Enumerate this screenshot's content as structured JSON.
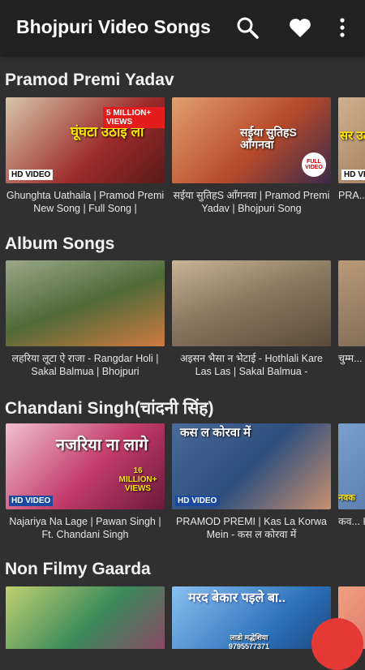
{
  "appbar": {
    "title": "Bhojpuri Video Songs"
  },
  "sections": [
    {
      "title": "Pramod Premi Yadav",
      "cards": [
        {
          "caption": "Ghunghta Uathaila | Pramod Premi New Song | Full Song |",
          "overlay": "घूंघटा उठाई ला",
          "badge": "5 MILLION+ VIEWS",
          "hd": "HD VIDEO",
          "color": "#9c2b2b"
        },
        {
          "caption": "सईया सुतिहS आँगनवा | Pramod Premi Yadav | Bhojpuri Song",
          "overlay": "सईया सुतिहS आँगनवा",
          "badge": "FULL VIDEO",
          "hd": "",
          "color": "#b84a2a"
        },
        {
          "caption": "PRA... - दर...",
          "overlay": "सर उठा",
          "badge": "",
          "hd": "HD VI",
          "color": "#7a5030"
        }
      ]
    },
    {
      "title": "Album Songs",
      "cards": [
        {
          "caption": "लहरिया लूटा ऐ राजा - Rangdar Holi | Sakal Balmua | Bhojpuri",
          "overlay": "",
          "badge": "",
          "hd": "",
          "color": "#4f6a38"
        },
        {
          "caption": "अइसन भैसा न भेटाई - Hothlali Kare Las Las | Sakal Balmua -",
          "overlay": "",
          "badge": "",
          "hd": "",
          "color": "#8a7a62"
        },
        {
          "caption": "चुम्म... Son...",
          "overlay": "",
          "badge": "",
          "hd": "",
          "color": "#6a5a48"
        }
      ]
    },
    {
      "title": "Chandani Singh(चांदनी सिंह)",
      "cards": [
        {
          "caption": "Najariya Na Lage | Pawan Singh | Ft. Chandani Singh",
          "overlay": "नजरिया ना लागे",
          "badge": "16 MILLION+ VIEWS",
          "hd": "HD VIDEO",
          "color": "#c23a6a"
        },
        {
          "caption": "PRAMOD PREMI | Kas La Korwa Mein - कस ल कोरवा में",
          "overlay": "कस ल कोरवा में",
          "badge": "",
          "hd": "HD VIDEO",
          "color": "#2e4f7e"
        },
        {
          "caption": "कव... Kaw...",
          "overlay": "नवक",
          "badge": "",
          "hd": "",
          "color": "#3a5a8a"
        }
      ]
    },
    {
      "title": "Non Filmy Gaarda",
      "cards": [
        {
          "caption": "",
          "overlay": "",
          "badge": "",
          "hd": "",
          "color": "#3a8a5a"
        },
        {
          "caption": "",
          "overlay": "मरद बेकार पइले बा..",
          "badge": "लाडो मद्धेशिया 9795577371",
          "hd": "",
          "color": "#2a6fb8"
        },
        {
          "caption": "",
          "overlay": "",
          "badge": "",
          "hd": "",
          "color": "#c0404a"
        }
      ]
    }
  ]
}
